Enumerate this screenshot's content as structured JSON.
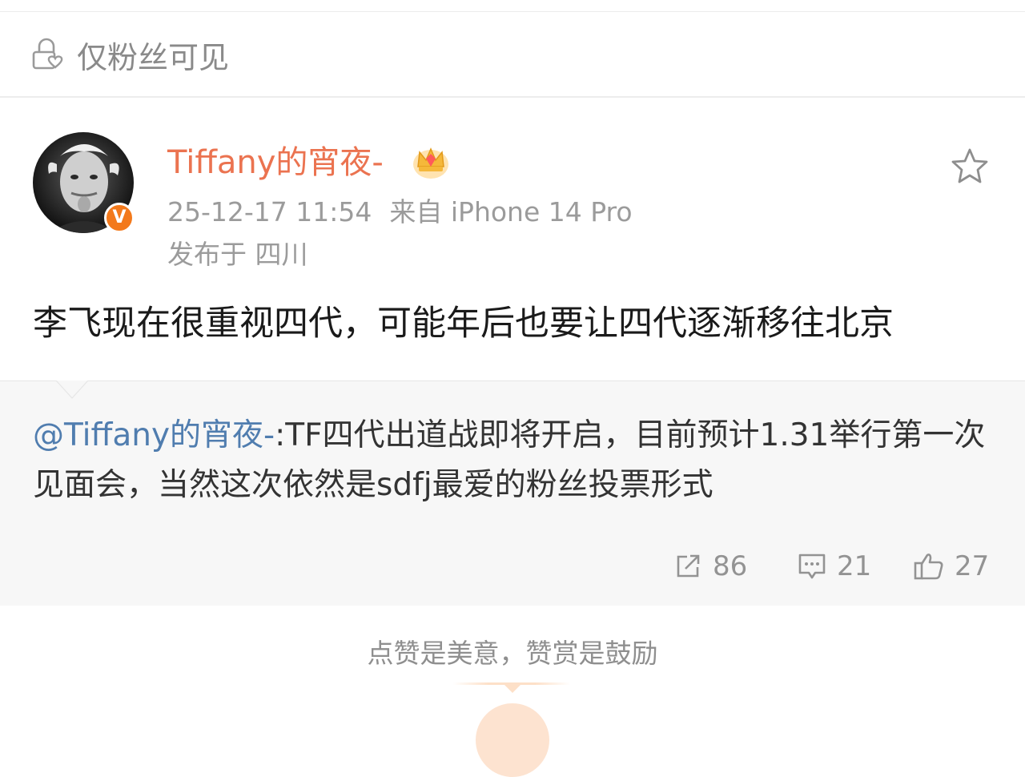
{
  "visibility": {
    "icon": "lock-heart-icon",
    "label": "仅粉丝可见"
  },
  "post": {
    "author": {
      "name": "Tiffany的宵夜-",
      "badge_icon": "crown-icon",
      "verified_icon": "verified-v-icon",
      "verified_label": "V"
    },
    "timestamp": "25-12-17 11:54",
    "source": "来自 iPhone 14 Pro",
    "location": "发布于 四川",
    "favorite_icon": "star-icon",
    "text": "李飞现在很重视四代，可能年后也要让四代逐渐移往北京"
  },
  "repost": {
    "mention": "@Tiffany的宵夜-",
    "text": ":TF四代出道战即将开启，目前预计1.31举行第一次见面会，当然这次依然是sdfj最爱的粉丝投票形式"
  },
  "actions": {
    "repost": {
      "icon": "share-icon",
      "count": "86"
    },
    "comment": {
      "icon": "comment-icon",
      "count": "21"
    },
    "like": {
      "icon": "thumbs-up-icon",
      "count": "27"
    }
  },
  "footer": {
    "encourage": "点赞是美意，赞赏是鼓励"
  },
  "colors": {
    "username": "#eb7350",
    "mention": "#507daf",
    "verified": "#f3791b",
    "secondary_text": "#9b9b9b"
  }
}
